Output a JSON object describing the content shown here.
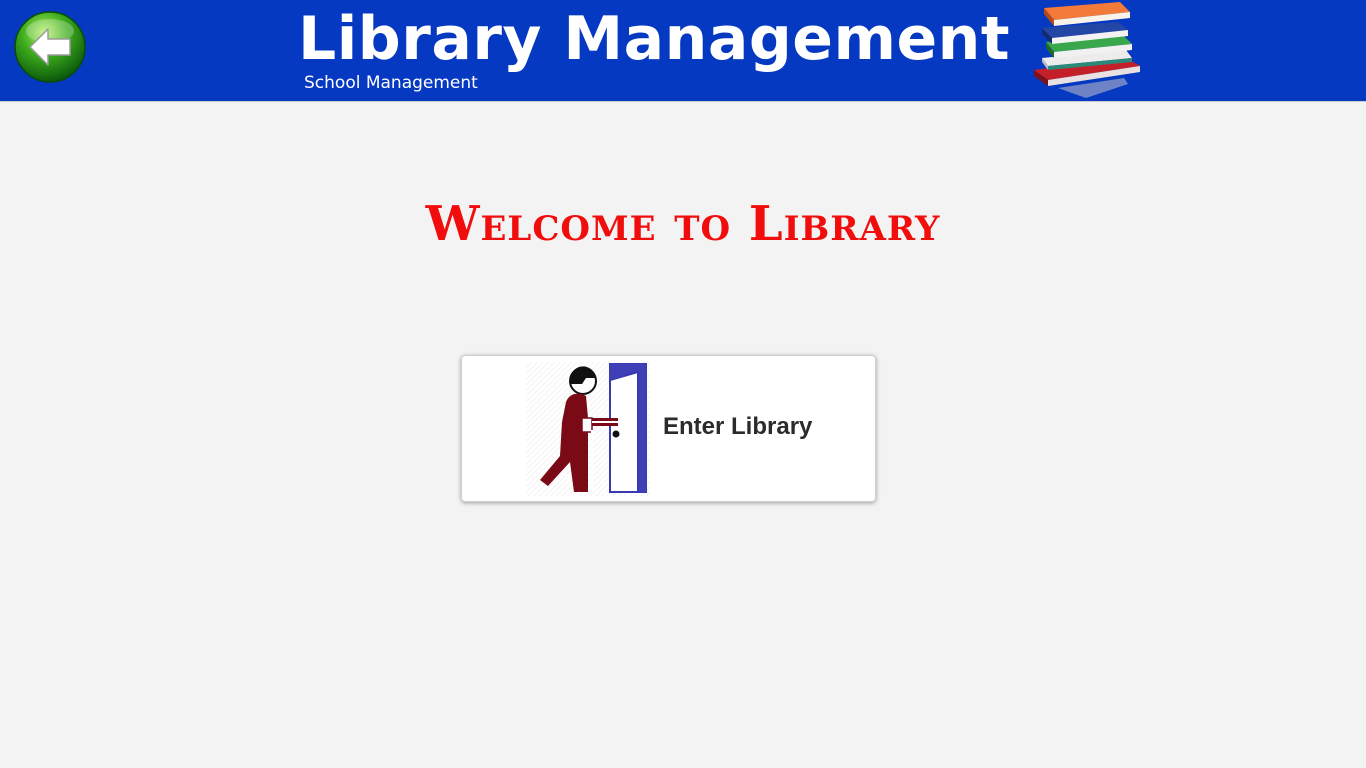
{
  "header": {
    "title": "Library Management",
    "subtitle": "School Management",
    "back_icon": "back-arrow-icon",
    "logo_icon": "books-stack-icon",
    "background_color": "#0639c2"
  },
  "main": {
    "welcome_text": "Welcome to Library",
    "welcome_color": "#f20d0d",
    "enter_button": {
      "label": "Enter Library",
      "icon": "person-entering-door-icon"
    }
  }
}
